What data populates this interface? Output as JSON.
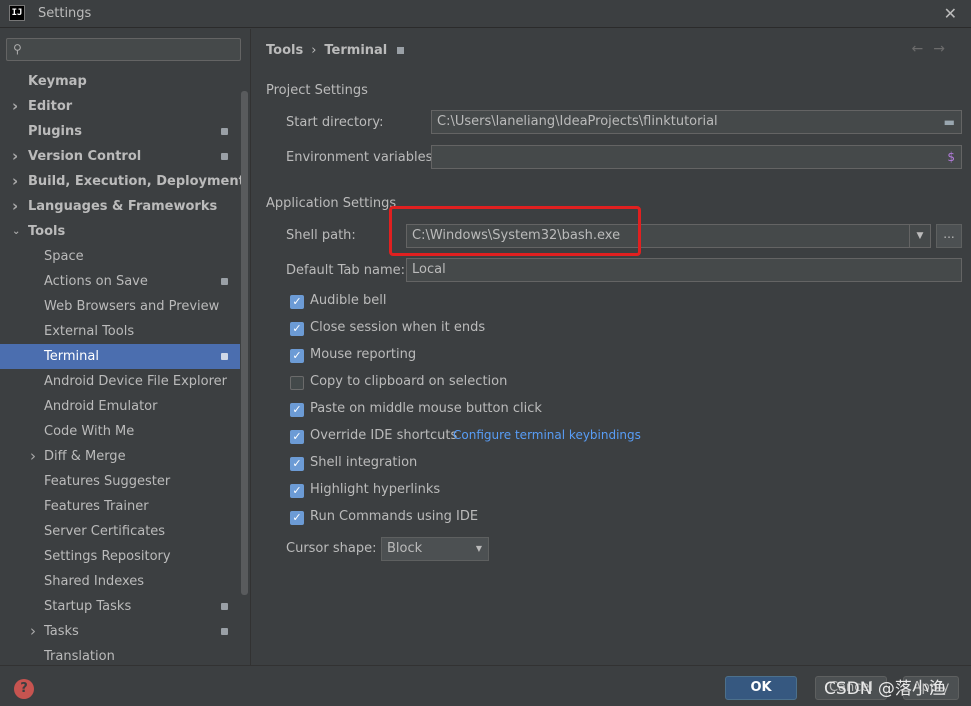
{
  "window": {
    "title": "Settings",
    "logo_text": "IJ"
  },
  "sidebar": {
    "search_placeholder": "",
    "items": [
      {
        "label": "Keymap",
        "bold": true,
        "arrow": "",
        "badge": false
      },
      {
        "label": "Editor",
        "bold": true,
        "arrow": ">",
        "badge": false
      },
      {
        "label": "Plugins",
        "bold": true,
        "arrow": "",
        "badge": true
      },
      {
        "label": "Version Control",
        "bold": true,
        "arrow": ">",
        "badge": true
      },
      {
        "label": "Build, Execution, Deployment",
        "bold": true,
        "arrow": ">",
        "badge": false
      },
      {
        "label": "Languages & Frameworks",
        "bold": true,
        "arrow": ">",
        "badge": false
      },
      {
        "label": "Tools",
        "bold": true,
        "arrow": "v",
        "badge": false
      },
      {
        "label": "Space",
        "bold": false,
        "arrow": "",
        "badge": false
      },
      {
        "label": "Actions on Save",
        "bold": false,
        "arrow": "",
        "badge": true
      },
      {
        "label": "Web Browsers and Preview",
        "bold": false,
        "arrow": "",
        "badge": false
      },
      {
        "label": "External Tools",
        "bold": false,
        "arrow": "",
        "badge": false
      },
      {
        "label": "Terminal",
        "bold": false,
        "arrow": "",
        "badge": true,
        "selected": true
      },
      {
        "label": "Android Device File Explorer",
        "bold": false,
        "arrow": "",
        "badge": false
      },
      {
        "label": "Android Emulator",
        "bold": false,
        "arrow": "",
        "badge": false
      },
      {
        "label": "Code With Me",
        "bold": false,
        "arrow": "",
        "badge": false
      },
      {
        "label": "Diff & Merge",
        "bold": false,
        "arrow": ">",
        "badge": false
      },
      {
        "label": "Features Suggester",
        "bold": false,
        "arrow": "",
        "badge": false
      },
      {
        "label": "Features Trainer",
        "bold": false,
        "arrow": "",
        "badge": false
      },
      {
        "label": "Server Certificates",
        "bold": false,
        "arrow": "",
        "badge": false
      },
      {
        "label": "Settings Repository",
        "bold": false,
        "arrow": "",
        "badge": false
      },
      {
        "label": "Shared Indexes",
        "bold": false,
        "arrow": "",
        "badge": false
      },
      {
        "label": "Startup Tasks",
        "bold": false,
        "arrow": "",
        "badge": true
      },
      {
        "label": "Tasks",
        "bold": false,
        "arrow": ">",
        "badge": true
      },
      {
        "label": "Translation",
        "bold": false,
        "arrow": "",
        "badge": false
      }
    ]
  },
  "breadcrumb": {
    "parent": "Tools",
    "separator": "›",
    "current": "Terminal"
  },
  "project_settings": {
    "title": "Project Settings",
    "start_dir_label": "Start directory:",
    "start_dir_value": "C:\\Users\\laneliang\\IdeaProjects\\flinktutorial",
    "env_label": "Environment variables:",
    "env_value": ""
  },
  "application_settings": {
    "title": "Application Settings",
    "shell_path_label": "Shell path:",
    "shell_path_value": "C:\\Windows\\System32\\bash.exe",
    "browse_label": "...",
    "default_tab_label": "Default Tab name:",
    "default_tab_value": "Local",
    "checkboxes": [
      {
        "label": "Audible bell",
        "checked": true
      },
      {
        "label": "Close session when it ends",
        "checked": true
      },
      {
        "label": "Mouse reporting",
        "checked": true
      },
      {
        "label": "Copy to clipboard on selection",
        "checked": false
      },
      {
        "label": "Paste on middle mouse button click",
        "checked": true
      },
      {
        "label": "Override IDE shortcuts",
        "checked": true,
        "link": "Configure terminal keybindings"
      },
      {
        "label": "Shell integration",
        "checked": true
      },
      {
        "label": "Highlight hyperlinks",
        "checked": true
      },
      {
        "label": "Run Commands using IDE",
        "checked": true
      }
    ],
    "cursor_shape_label": "Cursor shape:",
    "cursor_shape_value": "Block"
  },
  "footer": {
    "help": "?",
    "ok": "OK",
    "cancel": "Cancel",
    "apply": "Apply"
  },
  "watermark": "CSDN @落小渔",
  "colors": {
    "accent": "#4b6eaf",
    "highlight": "#e02020",
    "link": "#589df6"
  }
}
